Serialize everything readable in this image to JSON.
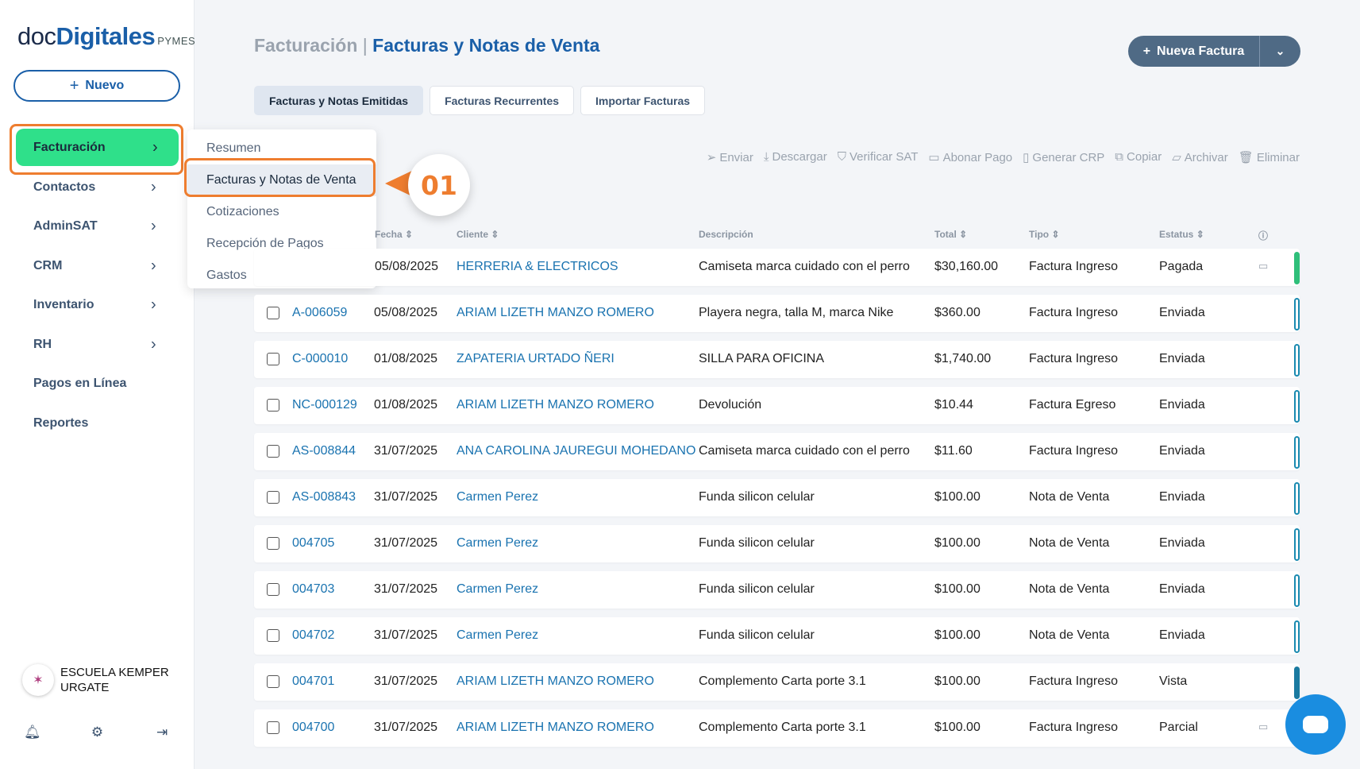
{
  "sidebar": {
    "logo": {
      "doc": "doc",
      "digitales": "Digitales",
      "pymes": "PYMES"
    },
    "new_button": "Nuevo",
    "items": [
      {
        "label": "Facturación",
        "has_chevron": true
      },
      {
        "label": "Contactos",
        "has_chevron": true
      },
      {
        "label": "AdminSAT",
        "has_chevron": true
      },
      {
        "label": "CRM",
        "has_chevron": true
      },
      {
        "label": "Inventario",
        "has_chevron": true
      },
      {
        "label": "RH",
        "has_chevron": true
      },
      {
        "label": "Pagos en Línea",
        "has_chevron": false
      },
      {
        "label": "Reportes",
        "has_chevron": false
      }
    ],
    "company": "ESCUELA KEMPER URGATE"
  },
  "submenu": {
    "items": [
      "Resumen",
      "Facturas y Notas de Venta",
      "Cotizaciones",
      "Recepción de Pagos",
      "Gastos"
    ],
    "callout": "01"
  },
  "header": {
    "breadcrumb_parent": "Facturación",
    "separator": "|",
    "title": "Facturas y Notas de Venta",
    "new_invoice_button": "Nueva Factura"
  },
  "tabs": [
    "Facturas y Notas Emitidas",
    "Facturas Recurrentes",
    "Importar Facturas"
  ],
  "toolbar": [
    "Enviar",
    "Descargar",
    "Verificar SAT",
    "Abonar Pago",
    "Generar CRP",
    "Copiar",
    "Archivar",
    "Eliminar"
  ],
  "table": {
    "headers": {
      "fecha": "Fecha",
      "cliente": "Cliente",
      "descripcion": "Descripción",
      "total": "Total",
      "tipo": "Tipo",
      "estatus": "Estatus"
    },
    "rows": [
      {
        "folio": "",
        "fecha": "05/08/2025",
        "cliente": "HERRERIA & ELECTRICOS",
        "descripcion": "Camiseta marca cuidado con el perro",
        "total": "$30,160.00",
        "tipo": "Factura Ingreso",
        "estatus": "Pagada"
      },
      {
        "folio": "A-006059",
        "fecha": "05/08/2025",
        "cliente": "ARIAM LIZETH MANZO ROMERO",
        "descripcion": "Playera negra, talla M, marca Nike",
        "total": "$360.00",
        "tipo": "Factura Ingreso",
        "estatus": "Enviada"
      },
      {
        "folio": "C-000010",
        "fecha": "01/08/2025",
        "cliente": "ZAPATERIA URTADO ÑERI",
        "descripcion": "SILLA PARA OFICINA",
        "total": "$1,740.00",
        "tipo": "Factura Ingreso",
        "estatus": "Enviada"
      },
      {
        "folio": "NC-000129",
        "fecha": "01/08/2025",
        "cliente": "ARIAM LIZETH MANZO ROMERO",
        "descripcion": "Devolución",
        "total": "$10.44",
        "tipo": "Factura Egreso",
        "estatus": "Enviada"
      },
      {
        "folio": "AS-008844",
        "fecha": "31/07/2025",
        "cliente": "ANA CAROLINA JAUREGUI MOHEDANO",
        "descripcion": "Camiseta marca cuidado con el perro",
        "total": "$11.60",
        "tipo": "Factura Ingreso",
        "estatus": "Enviada"
      },
      {
        "folio": "AS-008843",
        "fecha": "31/07/2025",
        "cliente": "Carmen Perez",
        "descripcion": "Funda silicon celular",
        "total": "$100.00",
        "tipo": "Nota de Venta",
        "estatus": "Enviada"
      },
      {
        "folio": "004705",
        "fecha": "31/07/2025",
        "cliente": "Carmen Perez",
        "descripcion": "Funda silicon celular",
        "total": "$100.00",
        "tipo": "Nota de Venta",
        "estatus": "Enviada"
      },
      {
        "folio": "004703",
        "fecha": "31/07/2025",
        "cliente": "Carmen Perez",
        "descripcion": "Funda silicon celular",
        "total": "$100.00",
        "tipo": "Nota de Venta",
        "estatus": "Enviada"
      },
      {
        "folio": "004702",
        "fecha": "31/07/2025",
        "cliente": "Carmen Perez",
        "descripcion": "Funda silicon celular",
        "total": "$100.00",
        "tipo": "Nota de Venta",
        "estatus": "Enviada"
      },
      {
        "folio": "004701",
        "fecha": "31/07/2025",
        "cliente": "ARIAM LIZETH MANZO ROMERO",
        "descripcion": "Complemento Carta porte 3.1",
        "total": "$100.00",
        "tipo": "Factura Ingreso",
        "estatus": "Vista"
      },
      {
        "folio": "004700",
        "fecha": "31/07/2025",
        "cliente": "ARIAM LIZETH MANZO ROMERO",
        "descripcion": "Complemento Carta porte 3.1",
        "total": "$100.00",
        "tipo": "Factura Ingreso",
        "estatus": "Parcial"
      }
    ]
  },
  "colors": {
    "accent": "#1a5fa8",
    "active_nav": "#2fe08a",
    "highlight": "#ee7d2f",
    "button": "#4f6a85"
  }
}
